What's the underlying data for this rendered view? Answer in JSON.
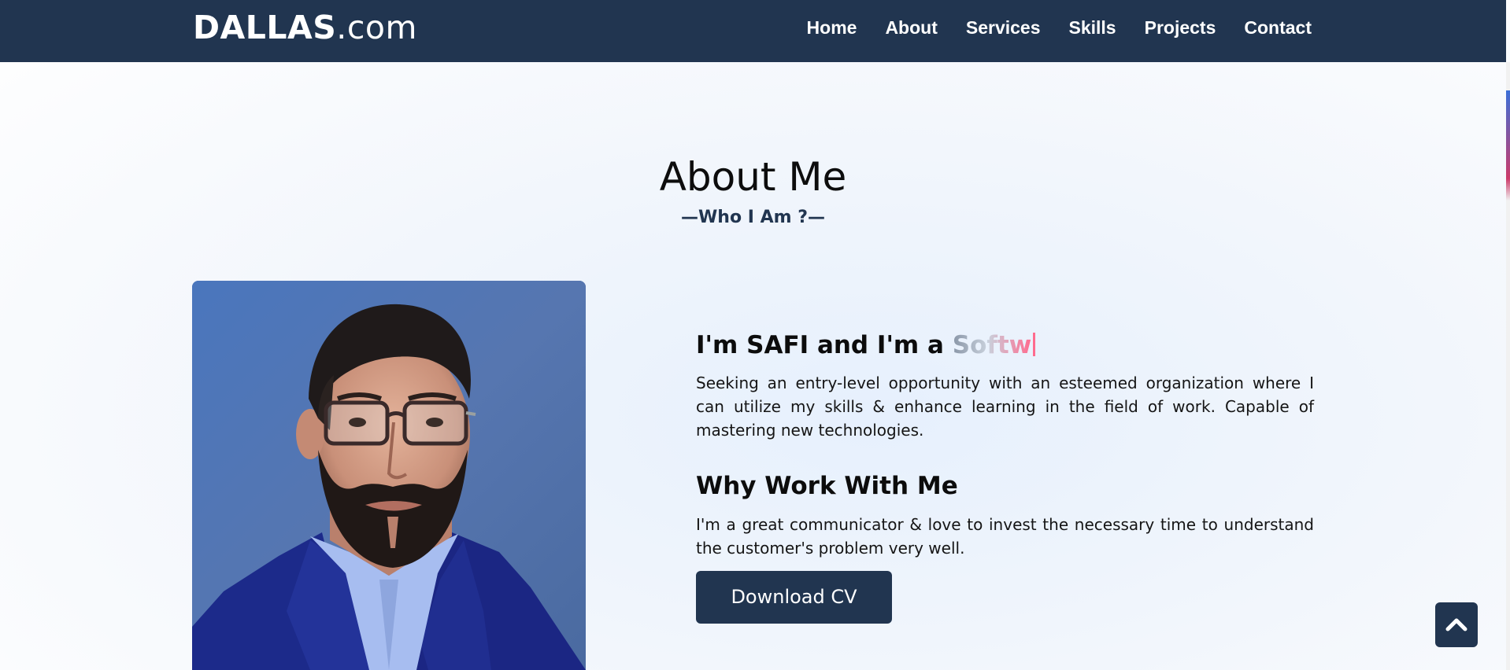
{
  "header": {
    "brand_name": "DALLAS",
    "brand_tld": ".com",
    "nav": [
      "Home",
      "About",
      "Services",
      "Skills",
      "Projects",
      "Contact"
    ]
  },
  "about": {
    "title": "About Me",
    "subtitle": "Who I Am ?",
    "intro_prefix": "I'm SAFI and I'm a ",
    "typed_text": "Softw",
    "description": "Seeking an entry-level opportunity with an esteemed organization where I can utilize my skills & enhance learning in the field of work. Capable of mastering new technologies.",
    "why_heading": "Why Work With Me",
    "why_text": "I'm a great communicator & love to invest the necessary time to understand the customer's problem very well.",
    "cv_button": "Download CV"
  },
  "colors": {
    "navbar": "#213550",
    "accent": "#213550",
    "typed_gradient_end": "#ff6b8e"
  },
  "icons": {
    "back_to_top": "chevron-up-icon"
  }
}
